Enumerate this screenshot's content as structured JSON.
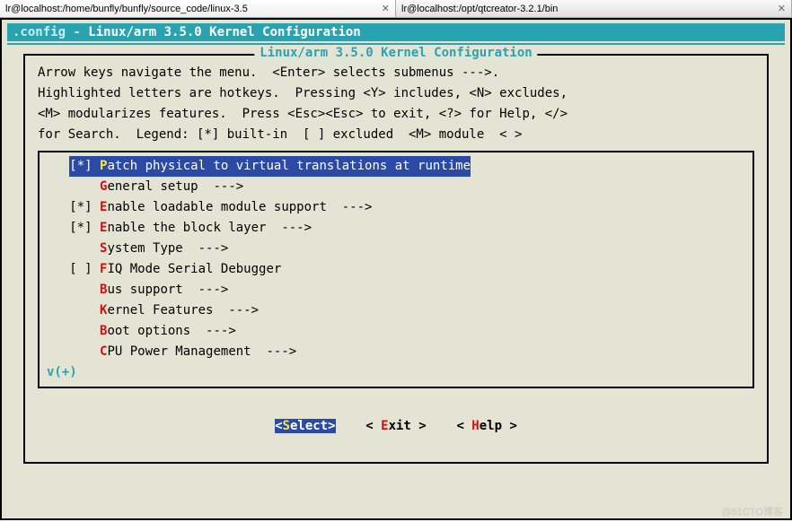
{
  "tabs": [
    {
      "label": "lr@localhost:/home/bunfly/bunfly/source_code/linux-3.5",
      "active": true,
      "closeGlyph": "✕"
    },
    {
      "label": "lr@localhost:/opt/qtcreator-3.2.1/bin",
      "active": false,
      "closeGlyph": "✕"
    }
  ],
  "title_prefix": ".config - ",
  "title_main": "Linux/arm 3.5.0 Kernel Configuration",
  "box_title": "Linux/arm 3.5.0 Kernel Configuration",
  "help_lines": [
    "Arrow keys navigate the menu.  <Enter> selects submenus --->.",
    "Highlighted letters are hotkeys.  Pressing <Y> includes, <N> excludes,",
    "<M> modularizes features.  Press <Esc><Esc> to exit, <?> for Help, </>",
    "for Search.  Legend: [*] built-in  [ ] excluded  <M> module  < >"
  ],
  "menu": [
    {
      "prefix": "[*] ",
      "hot": "P",
      "rest": "atch physical to virtual translations at runtime",
      "selected": true
    },
    {
      "prefix": "    ",
      "hot": "G",
      "rest": "eneral setup  --->",
      "selected": false
    },
    {
      "prefix": "[*] ",
      "hot": "E",
      "rest": "nable loadable module support  --->",
      "selected": false
    },
    {
      "prefix": "[*] ",
      "hot": "E",
      "rest": "nable the block layer  --->",
      "selected": false
    },
    {
      "prefix": "    ",
      "hot": "S",
      "rest": "ystem Type  --->",
      "selected": false
    },
    {
      "prefix": "[ ] ",
      "hot": "F",
      "rest": "IQ Mode Serial Debugger",
      "selected": false
    },
    {
      "prefix": "    ",
      "hot": "B",
      "rest": "us support  --->",
      "selected": false
    },
    {
      "prefix": "    ",
      "hot": "K",
      "rest": "ernel Features  --->",
      "selected": false
    },
    {
      "prefix": "    ",
      "hot": "B",
      "rest": "oot options  --->",
      "selected": false
    },
    {
      "prefix": "    ",
      "hot": "C",
      "rest": "PU Power Management  --->",
      "selected": false
    }
  ],
  "scroll_hint": "v(+)",
  "buttons": {
    "select_pre": "<",
    "select_hot": "S",
    "select_post": "elect>",
    "exit_pre": "< ",
    "exit_hot": "E",
    "exit_post": "xit >",
    "help_pre": "< ",
    "help_hot": "H",
    "help_post": "elp >"
  },
  "watermark": "@51CTO博客"
}
